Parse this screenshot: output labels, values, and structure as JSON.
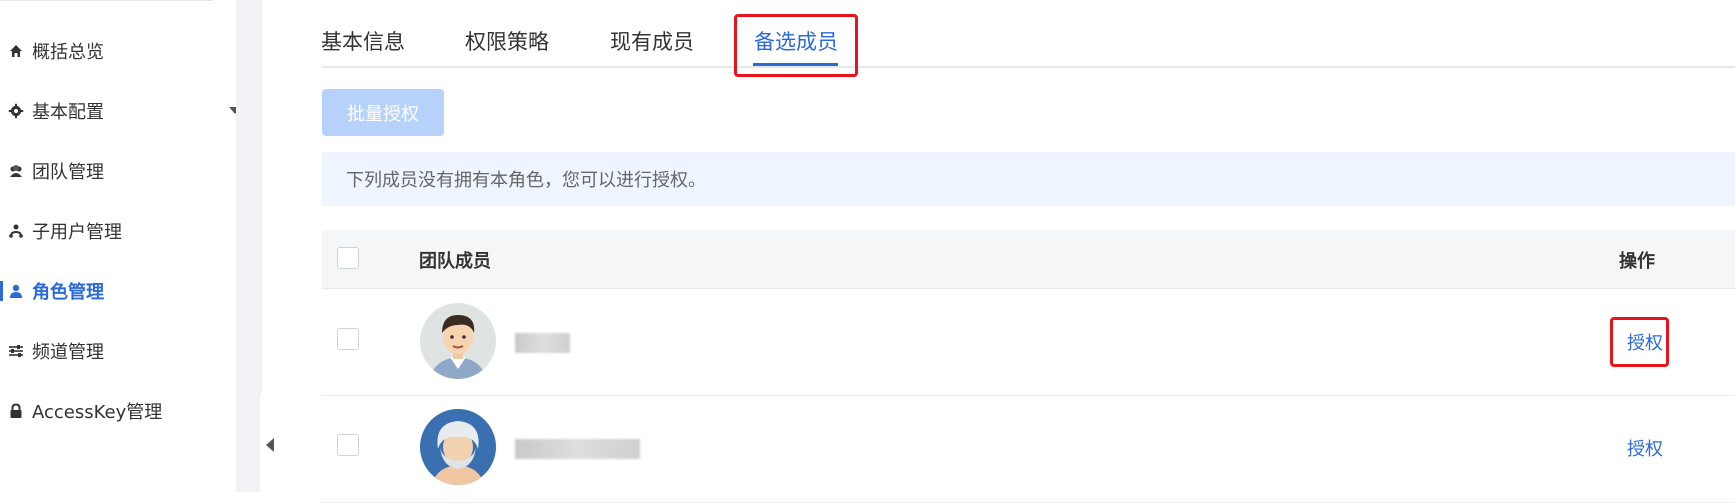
{
  "sidebar": {
    "items": [
      {
        "label": "概括总览",
        "icon": "home-icon"
      },
      {
        "label": "基本配置",
        "icon": "gear-icon"
      },
      {
        "label": "团队管理",
        "icon": "team-icon"
      },
      {
        "label": "子用户管理",
        "icon": "sitemap-icon"
      },
      {
        "label": "角色管理",
        "icon": "user-icon",
        "active": true
      },
      {
        "label": "频道管理",
        "icon": "sliders-icon"
      },
      {
        "label": "AccessKey管理",
        "icon": "lock-icon"
      }
    ]
  },
  "tabs": [
    {
      "label": "基本信息"
    },
    {
      "label": "权限策略"
    },
    {
      "label": "现有成员"
    },
    {
      "label": "备选成员",
      "active": true
    }
  ],
  "toolbar": {
    "batch_label": "批量授权"
  },
  "notice": {
    "text": "下列成员没有拥有本角色，您可以进行授权。"
  },
  "table": {
    "headers": {
      "member": "团队成员",
      "action": "操作"
    },
    "rows": [
      {
        "avatar": "male-avatar",
        "action": "授权"
      },
      {
        "avatar": "elder-avatar",
        "action": "授权"
      }
    ]
  },
  "colors": {
    "accent": "#2b6bd8",
    "highlight": "#e8141b",
    "button_disabled": "#b6d2fb"
  }
}
